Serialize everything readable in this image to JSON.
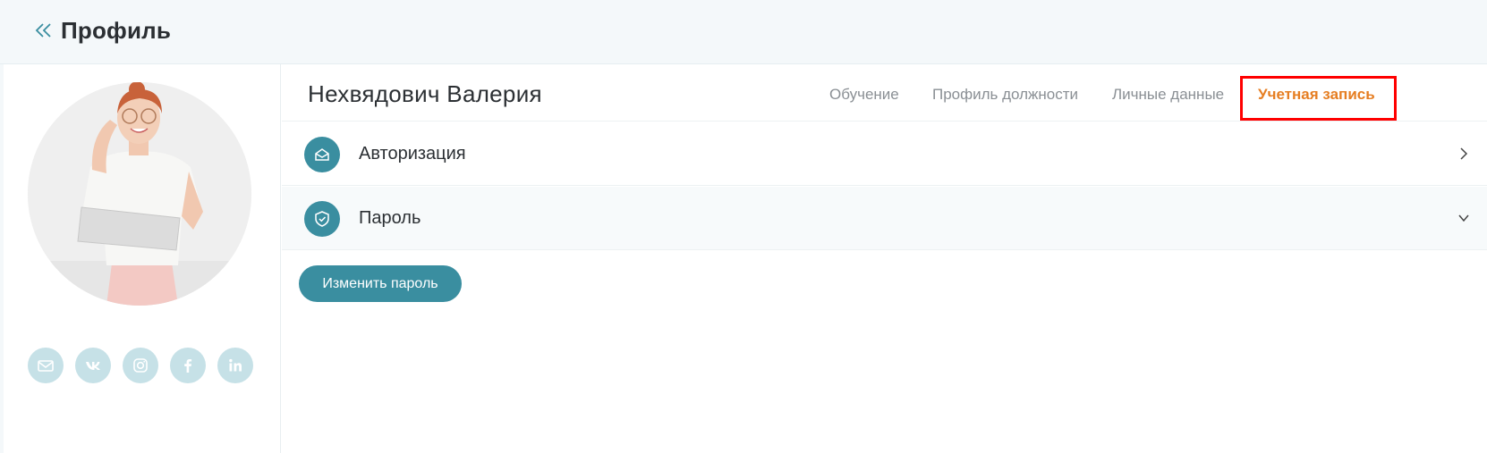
{
  "header": {
    "back_icon": "double-chevron-left-icon",
    "title": "Профиль"
  },
  "sidebar": {
    "avatar": "user-photo",
    "socials": [
      {
        "name": "email",
        "icon": "mail-icon"
      },
      {
        "name": "vk",
        "icon": "vk-icon"
      },
      {
        "name": "instagram",
        "icon": "instagram-icon"
      },
      {
        "name": "facebook",
        "icon": "facebook-icon"
      },
      {
        "name": "linkedin",
        "icon": "linkedin-icon"
      }
    ]
  },
  "profile": {
    "name": "Нехвядович Валерия",
    "tabs": [
      {
        "label": "Обучение",
        "active": false
      },
      {
        "label": "Профиль должности",
        "active": false
      },
      {
        "label": "Личные данные",
        "active": false
      },
      {
        "label": "Учетная запись",
        "active": true
      }
    ]
  },
  "sections": {
    "auth": {
      "label": "Авторизация",
      "icon": "envelope-open-icon",
      "state": "collapsed"
    },
    "password": {
      "label": "Пароль",
      "icon": "shield-check-icon",
      "state": "expanded"
    }
  },
  "actions": {
    "change_password": "Изменить пароль"
  },
  "colors": {
    "accent": "#3a8ea0",
    "active_tab": "#e67e22",
    "social_bg": "#c6e1e7",
    "highlight": "#ff0000"
  }
}
